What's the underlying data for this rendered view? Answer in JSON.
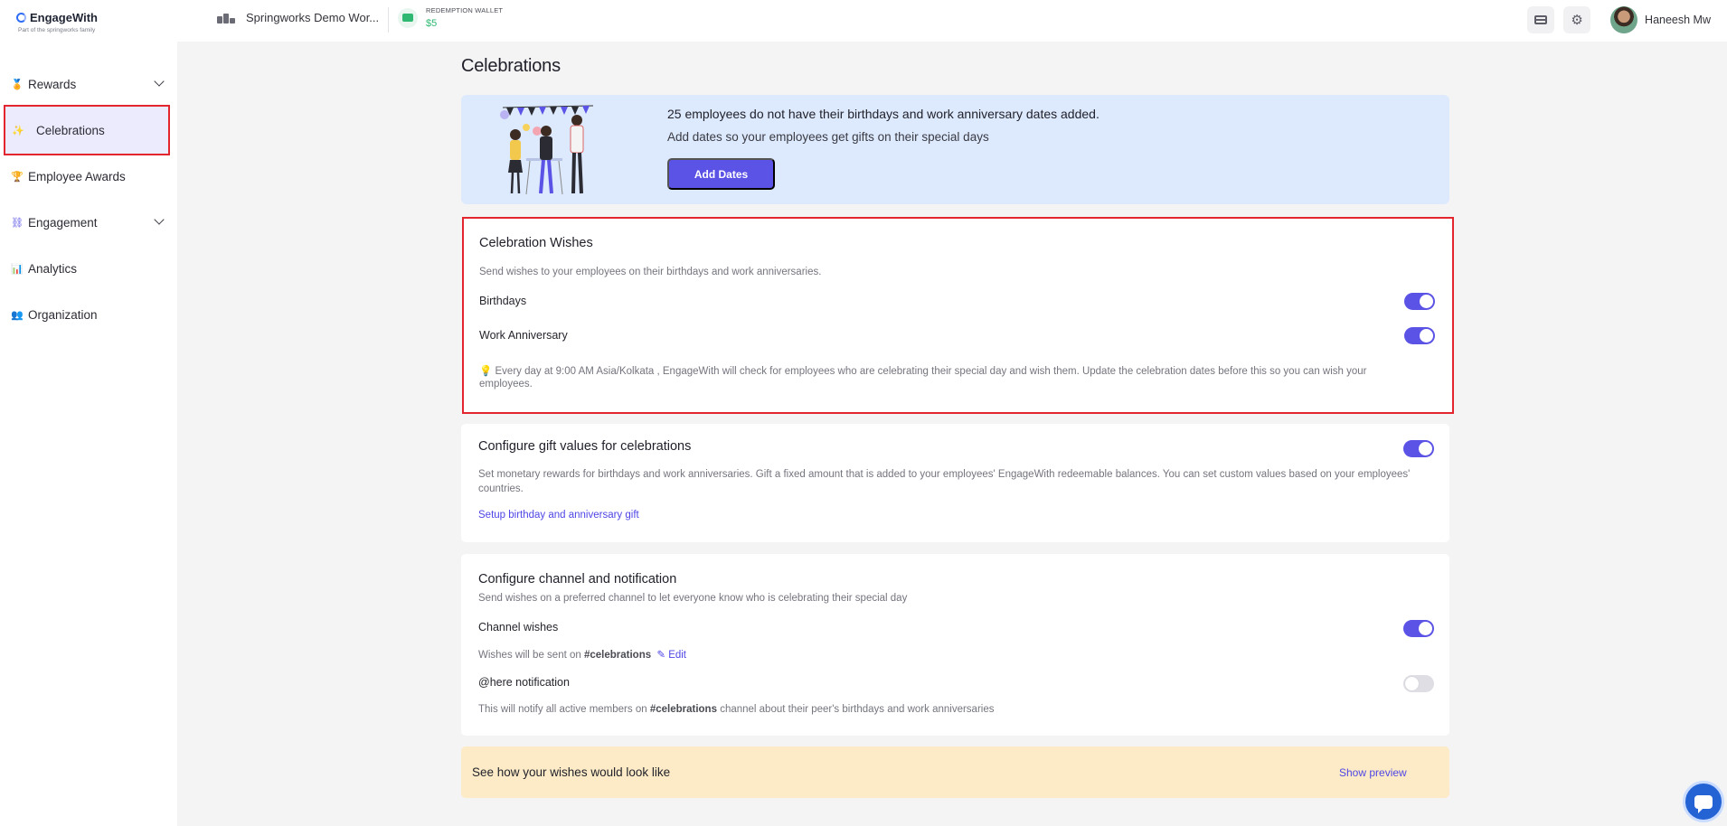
{
  "header": {
    "brand_name": "EngageWith",
    "brand_tagline": "Part of the springworks family",
    "workspace_name": "Springworks Demo Wor...",
    "wallet_label": "REDEMPTION WALLET",
    "wallet_amount": "$5",
    "user_name": "Haneesh Mw",
    "icons": [
      "billing-card-icon",
      "settings-gear-icon"
    ]
  },
  "sidebar": {
    "items": [
      {
        "label": "Rewards",
        "icon": "medal-icon",
        "expandable": true
      },
      {
        "label": "Celebrations",
        "icon": "confetti-icon",
        "active": true
      },
      {
        "label": "Employee Awards",
        "icon": "trophy-icon"
      },
      {
        "label": "Engagement",
        "icon": "engagement-icon",
        "expandable": true
      },
      {
        "label": "Analytics",
        "icon": "bar-chart-icon"
      },
      {
        "label": "Organization",
        "icon": "people-icon"
      }
    ]
  },
  "page": {
    "title": "Celebrations"
  },
  "banner": {
    "title": "25 employees do not have their birthdays and work anniversary dates added.",
    "subtitle": "Add dates so your employees get gifts on their special days",
    "button": "Add Dates"
  },
  "wishes": {
    "title": "Celebration Wishes",
    "description": "Send wishes to your employees on their birthdays and work anniversaries.",
    "birthdays_label": "Birthdays",
    "birthdays_on": true,
    "anniversary_label": "Work Anniversary",
    "anniversary_on": true,
    "note_line1": "💡 Every day at 9:00 AM Asia/Kolkata , EngageWith will check for employees who are celebrating their special day and wish them. Update the celebration dates before this so you can wish your",
    "note_line2": "employees."
  },
  "gifts": {
    "title": "Configure gift values for celebrations",
    "enabled": true,
    "description_line1": "Set monetary rewards for birthdays and work anniversaries. Gift a fixed amount that is added to your employees' EngageWith redeemable balances. You can set custom values based on your employees'",
    "description_line2": "countries.",
    "setup_link": "Setup birthday and anniversary gift"
  },
  "channel": {
    "title": "Configure channel and notification",
    "description": "Send wishes on a preferred channel to let everyone know who is celebrating their special day",
    "channel_wishes_label": "Channel wishes",
    "channel_wishes_on": true,
    "sent_on_prefix": "Wishes will be sent on",
    "channel_name": "#celebrations",
    "edit_label": "Edit",
    "here_label": "@here notification",
    "here_on": false,
    "here_desc_prefix": "This will notify all active members on",
    "here_desc_channel": "#celebrations",
    "here_desc_suffix": "channel about their peer's birthdays and work anniversaries"
  },
  "preview": {
    "text": "See how your wishes would look like",
    "link": "Show preview"
  },
  "colors": {
    "accent": "#5b52e6",
    "highlight_border": "#e3262e",
    "banner_bg": "#dde9fd",
    "preview_bg": "#fdebc7",
    "wallet_green": "#2eb872"
  }
}
